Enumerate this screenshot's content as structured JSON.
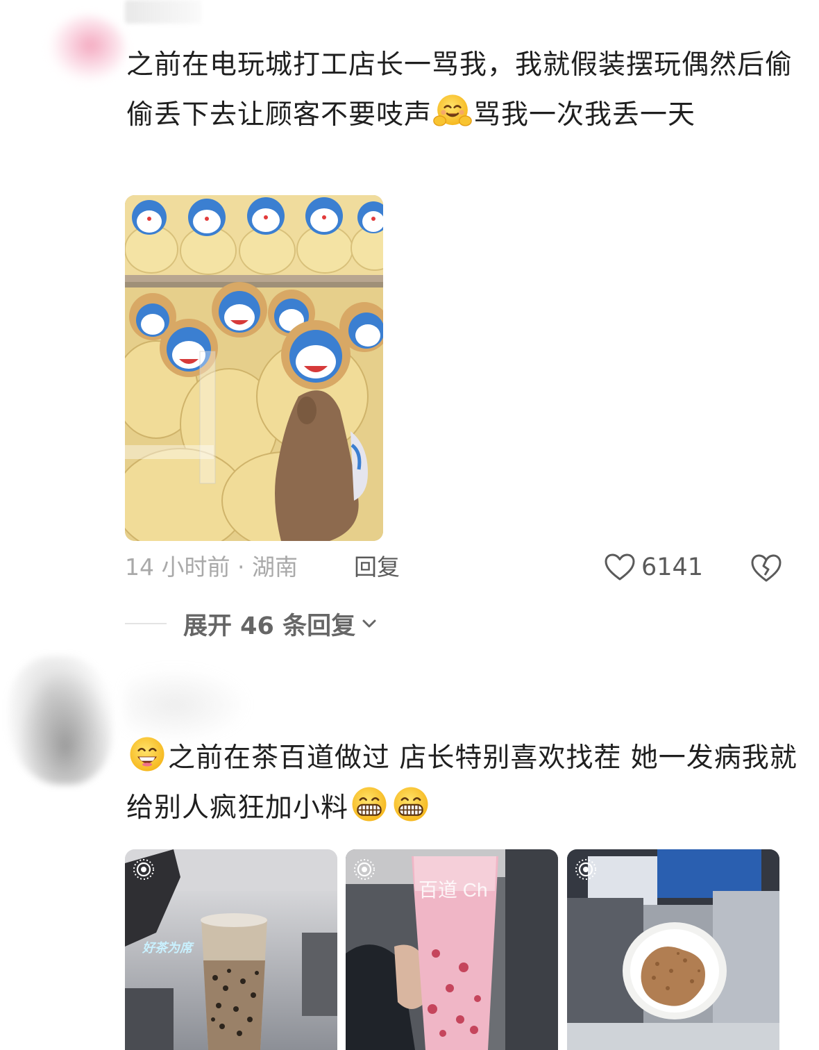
{
  "comment1": {
    "text_part1": "之前在电玩城打工店长一骂我，我就假装摆玩偶然后偷偷丢下去让顾客不要吱声",
    "emoji": "hugging-face-emoji",
    "text_part2": "骂我一次我丢一天",
    "image": "claw-machine-doraemon-plush-photo",
    "time_location": "14 小时前 · 湖南",
    "reply_label": "回复",
    "like_count": "6141",
    "expand_replies_label": "展开 46 条回复"
  },
  "comment2": {
    "emoji_lead": "grinning-face-emoji",
    "text_part1": "之前在茶百道做过 店长特别喜欢找茬 她一发病我就给别人疯狂加小料",
    "emoji_trail": [
      "beaming-face-emoji",
      "beaming-face-emoji"
    ],
    "images": [
      {
        "name": "milk-tea-cup-photo",
        "overlay_text": "好茶为席"
      },
      {
        "name": "pink-drink-cup-photo",
        "overlay_text": "百道 Ch"
      },
      {
        "name": "cocoa-powder-bowl-photo"
      }
    ]
  },
  "colors": {
    "meta_gray": "#a9a9a9",
    "action_gray": "#5a5a5a",
    "text": "#1f1f1f"
  }
}
